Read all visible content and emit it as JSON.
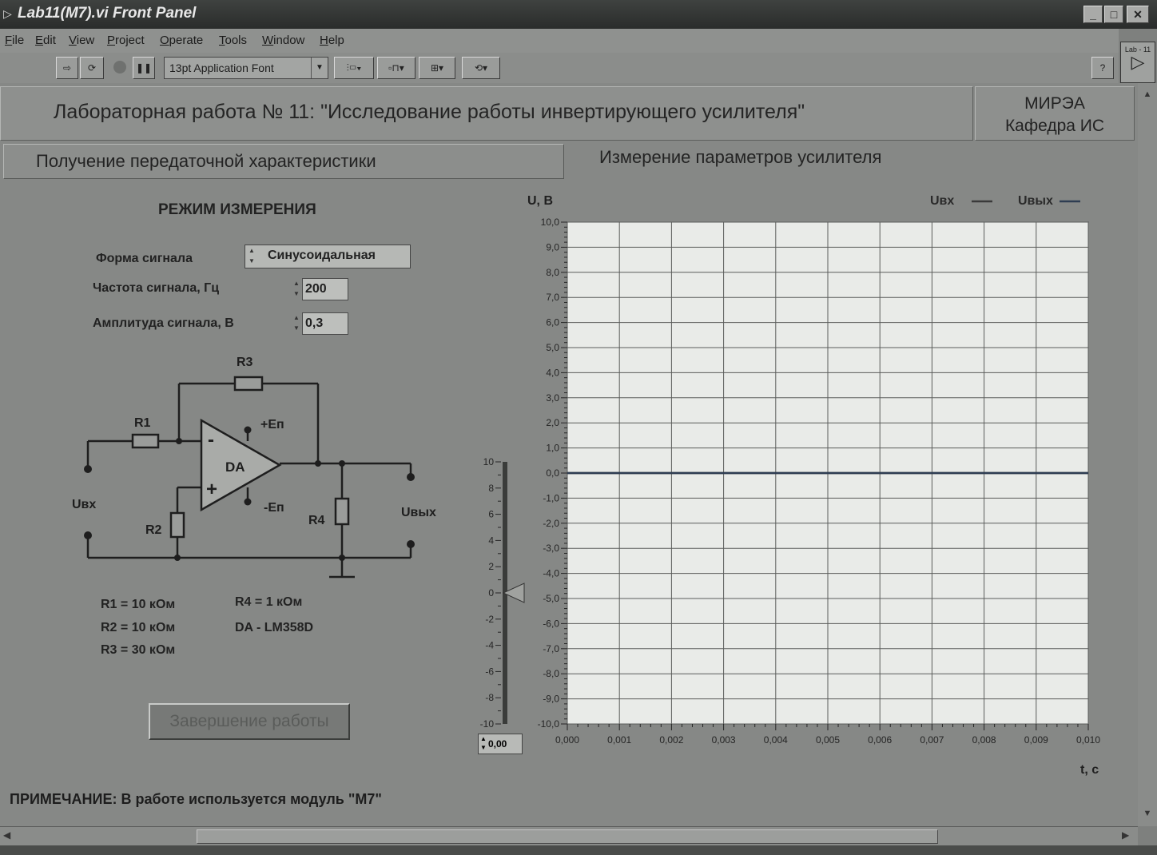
{
  "window": {
    "title": "Lab11(M7).vi Front Panel",
    "minimize": "_",
    "maximize": "□",
    "close": "✕"
  },
  "menu": [
    "File",
    "Edit",
    "View",
    "Project",
    "Operate",
    "Tools",
    "Window",
    "Help"
  ],
  "toolbar": {
    "font": "13pt Application Font",
    "help": "?"
  },
  "vi_icon_label": "Lab - 11",
  "header": {
    "title": "Лабораторная работа № 11: \"Исследование работы инвертирующего усилителя\"",
    "org_line1": "МИРЭА",
    "org_line2": "Кафедра ИС"
  },
  "tabs": {
    "left": "Получение передаточной характеристики",
    "right": "Измерение параметров усилителя"
  },
  "mode": {
    "title": "РЕЖИМ ИЗМЕРЕНИЯ",
    "signal_form_label": "Форма сигнала",
    "signal_form_value": "Синусоидальная",
    "frequency_label": "Частота сигнала, Гц",
    "frequency_value": "200",
    "amplitude_label": "Амплитуда сигнала, В",
    "amplitude_value": "0,3"
  },
  "circuit": {
    "r1": "R1",
    "r2": "R2",
    "r3": "R3",
    "r4": "R4",
    "da": "DA",
    "plus_en": "+Eп",
    "minus_en": "-Eп",
    "minus_sign": "-",
    "plus_sign": "+",
    "uin": "Uвх",
    "uout": "Uвых"
  },
  "components": {
    "r1": "R1 = 10 кОм",
    "r2": "R2 = 10 кОм",
    "r3": "R3 = 30 кОм",
    "r4": "R4 = 1 кОм",
    "da": "DA - LM358D"
  },
  "finish_button": "Завершение работы",
  "note": "ПРИМЕЧАНИЕ: В работе используется модуль \"М7\"",
  "slider": {
    "ticks": [
      "10",
      "8",
      "6",
      "4",
      "2",
      "0",
      "-2",
      "-4",
      "-6",
      "-8",
      "-10"
    ],
    "value": 0,
    "readout": "0,00"
  },
  "chart_data": {
    "type": "line",
    "ylabel": "U, В",
    "xlabel": "t, c",
    "xlim": [
      0,
      0.01
    ],
    "ylim": [
      -10,
      10
    ],
    "x_ticks": [
      "0,000",
      "0,001",
      "0,002",
      "0,003",
      "0,004",
      "0,005",
      "0,006",
      "0,007",
      "0,008",
      "0,009",
      "0,010"
    ],
    "y_ticks": [
      "10,0",
      "9,0",
      "8,0",
      "7,0",
      "6,0",
      "5,0",
      "4,0",
      "3,0",
      "2,0",
      "1,0",
      "0,0",
      "-1,0",
      "-2,0",
      "-3,0",
      "-4,0",
      "-5,0",
      "-6,0",
      "-7,0",
      "-8,0",
      "-9,0",
      "-10,0"
    ],
    "grid": true,
    "legend_position": "top-right",
    "series": [
      {
        "name": "Uвх",
        "color": "#3a3a3a",
        "x": [
          0,
          0.01
        ],
        "y": [
          0,
          0
        ]
      },
      {
        "name": "Uвых",
        "color": "#2e3d52",
        "x": [
          0,
          0.01
        ],
        "y": [
          0,
          0
        ]
      }
    ]
  }
}
